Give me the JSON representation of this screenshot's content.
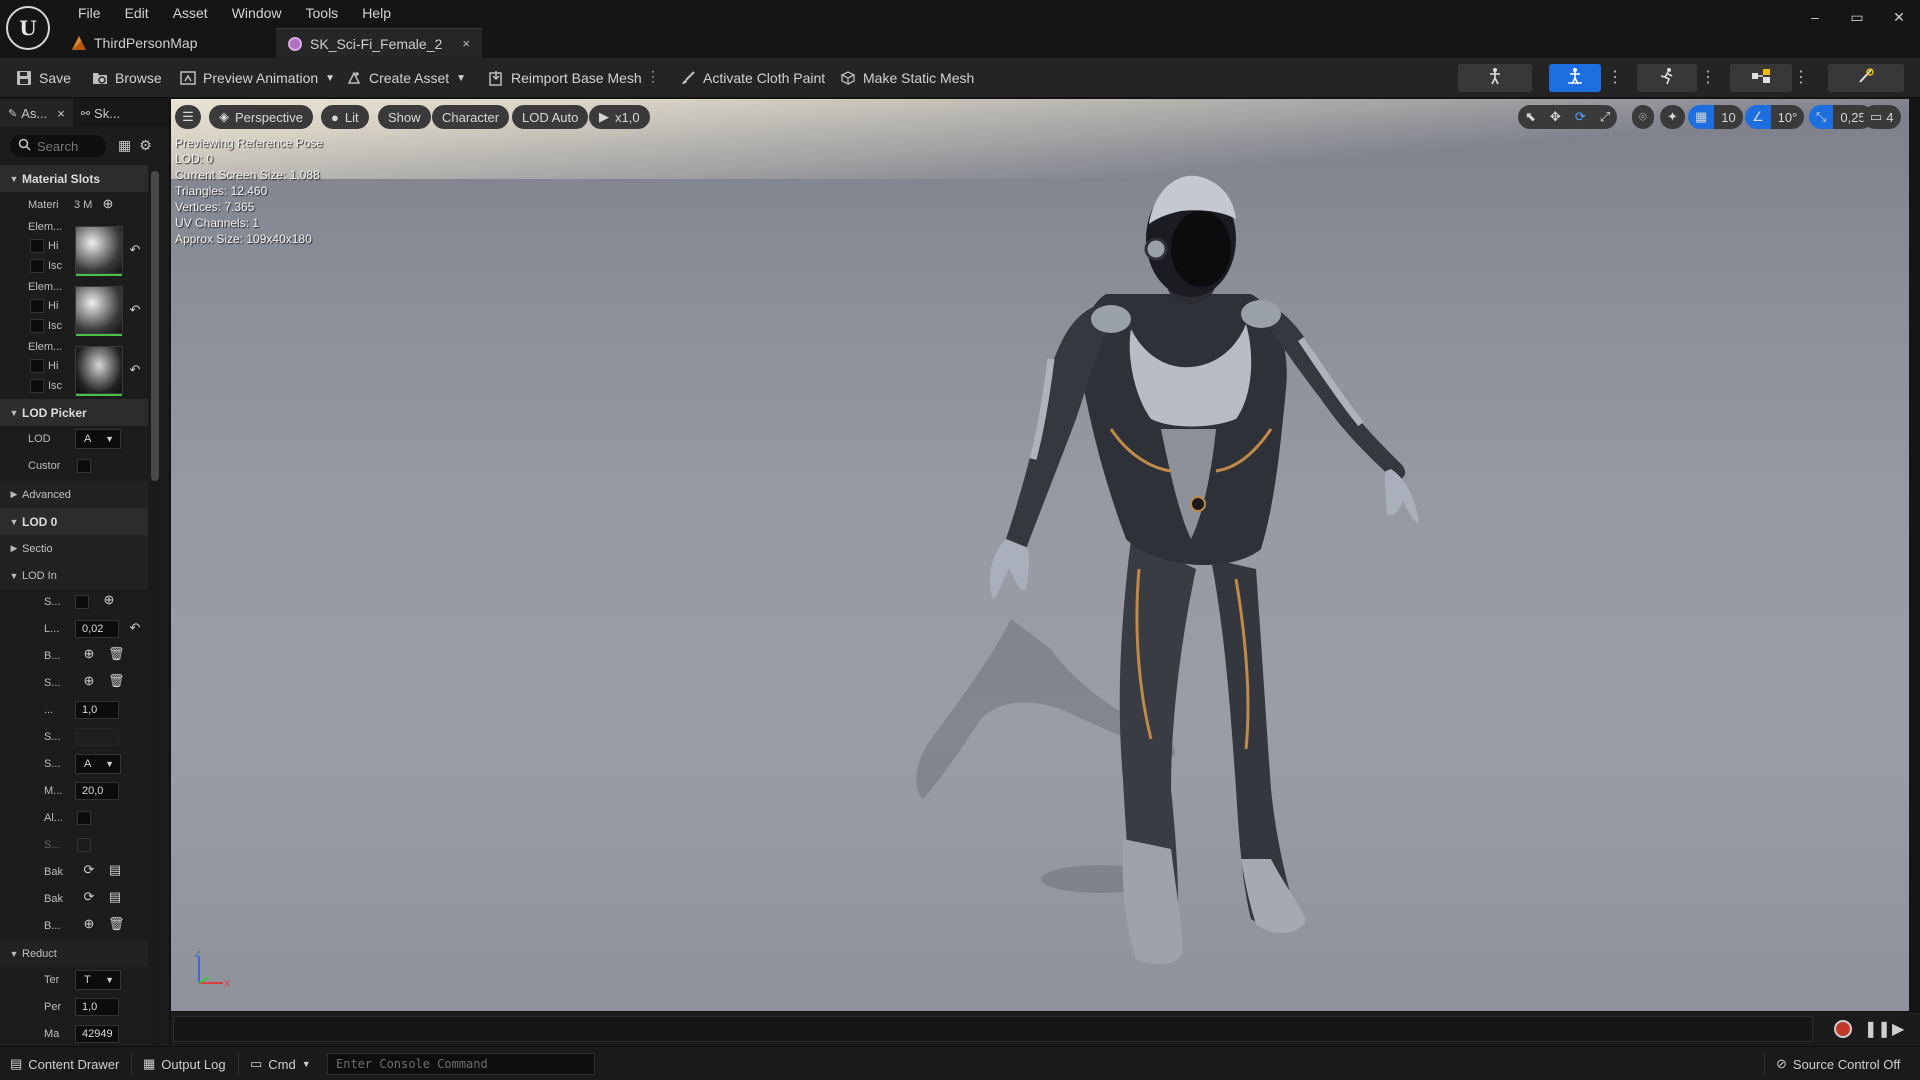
{
  "app": {
    "logo_text": "U",
    "menu": [
      "File",
      "Edit",
      "Asset",
      "Window",
      "Tools",
      "Help"
    ],
    "window_controls": [
      "–",
      "▭",
      "✕"
    ]
  },
  "tabs": [
    {
      "label": "ThirdPersonMap",
      "icon": "map-icon"
    },
    {
      "label": "SK_Sci-Fi_Female_2",
      "icon": "skeletal-mesh-icon",
      "close": "×"
    }
  ],
  "toolbar": {
    "save": "Save",
    "browse": "Browse",
    "preview_animation": "Preview Animation",
    "create_asset": "Create Asset",
    "reimport": "Reimport Base Mesh",
    "cloth_paint": "Activate Cloth Paint",
    "static_mesh": "Make Static Mesh"
  },
  "left_panel": {
    "tabs": [
      "As...",
      "Sk..."
    ],
    "tab_close": "×",
    "search_placeholder": "Search",
    "material_slots": "Material Slots",
    "materials_label": "Materi",
    "materials_count": "3 M",
    "elements": [
      {
        "label": "Elem...",
        "highlight": "Hi",
        "isolate": "Isc"
      },
      {
        "label": "Elem...",
        "highlight": "Hi",
        "isolate": "Isc"
      },
      {
        "label": "Elem...",
        "highlight": "Hi",
        "isolate": "Isc"
      }
    ],
    "lod_picker": "LOD Picker",
    "lod_label": "LOD",
    "lod_value": "A",
    "custom_label": "Custor",
    "advanced": "Advanced",
    "lod0": "LOD 0",
    "sections": "Sectio",
    "lod_info": "LOD In",
    "props": {
      "s1": "S...",
      "l1": "L...",
      "l1_value": "0,02",
      "b1": "B...",
      "s2": "S...",
      "dots": "...",
      "dots_value": "1,0",
      "s3": "S...",
      "s4": "S...",
      "s4_value": "A",
      "m1": "M...",
      "m1_value": "20,0",
      "al": "Al...",
      "s5": "S...",
      "bak1": "Bak",
      "bak2": "Bak",
      "b2": "B..."
    },
    "reduction": "Reduct",
    "ter_label": "Ter",
    "ter_value": "T",
    "per_label": "Per",
    "per_value": "1,0",
    "ma_label": "Ma",
    "ma_value": "42949"
  },
  "viewport": {
    "buttons": {
      "perspective": "Perspective",
      "lit": "Lit",
      "show": "Show",
      "character": "Character",
      "lod": "LOD Auto",
      "speed": "x1,0"
    },
    "stats": [
      "Previewing Reference Pose",
      "LOD: 0",
      "Current Screen Size: 1,088",
      "Triangles: 12.460",
      "Vertices: 7.365",
      "UV Channels: 1",
      "Approx Size: 109x40x180"
    ],
    "right_tools": {
      "grid": "10",
      "angle": "10°",
      "scale": "0,25",
      "camera": "4"
    },
    "axis": {
      "z": "Z",
      "x": "X"
    }
  },
  "statusbar": {
    "content_drawer": "Content Drawer",
    "output_log": "Output Log",
    "cmd": "Cmd",
    "console_placeholder": "Enter Console Command",
    "source_control": "Source Control Off"
  },
  "colors": {
    "accent": "#1d6fe0",
    "background": "#151515",
    "panel": "#1c1c1c",
    "viewport_floor": "#979aa4"
  }
}
